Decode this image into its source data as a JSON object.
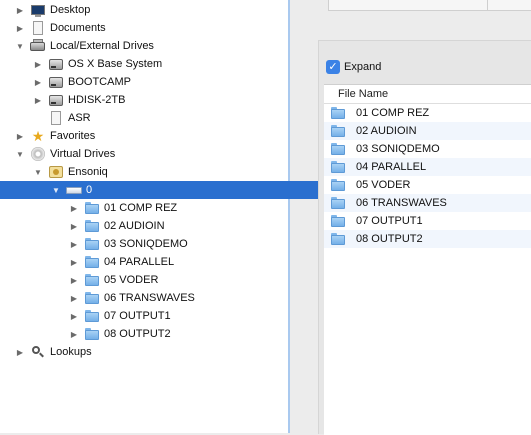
{
  "tree": {
    "items": [
      {
        "label": "Desktop",
        "icon": "desktop-icon",
        "expanded": false
      },
      {
        "label": "Documents",
        "icon": "documents-icon",
        "expanded": false
      },
      {
        "label": "Local/External Drives",
        "icon": "drives-icon",
        "expanded": true
      },
      {
        "label": "OS X Base System",
        "icon": "disk-icon",
        "expanded": false
      },
      {
        "label": "BOOTCAMP",
        "icon": "disk-icon",
        "expanded": false
      },
      {
        "label": "HDISK-2TB",
        "icon": "disk-icon",
        "expanded": false
      },
      {
        "label": "ASR",
        "icon": "document-icon",
        "expanded": false
      },
      {
        "label": "Favorites",
        "icon": "star-icon",
        "expanded": false
      },
      {
        "label": "Virtual Drives",
        "icon": "cd-icon",
        "expanded": true
      },
      {
        "label": "Ensoniq",
        "icon": "ensoniq-icon",
        "expanded": true
      },
      {
        "label": "0",
        "icon": "volume-icon",
        "expanded": true,
        "selected": true
      },
      {
        "label": "01 COMP REZ",
        "icon": "folder-icon",
        "expanded": false
      },
      {
        "label": "02 AUDIOIN",
        "icon": "folder-icon",
        "expanded": false
      },
      {
        "label": "03 SONIQDEMO",
        "icon": "folder-icon",
        "expanded": false
      },
      {
        "label": "04 PARALLEL",
        "icon": "folder-icon",
        "expanded": false
      },
      {
        "label": "05 VODER",
        "icon": "folder-icon",
        "expanded": false
      },
      {
        "label": "06 TRANSWAVES",
        "icon": "folder-icon",
        "expanded": false
      },
      {
        "label": "07 OUTPUT1",
        "icon": "folder-icon",
        "expanded": false
      },
      {
        "label": "08 OUTPUT2",
        "icon": "folder-icon",
        "expanded": false
      },
      {
        "label": "Lookups",
        "icon": "search-icon",
        "expanded": false
      }
    ]
  },
  "right_panel": {
    "expand_label": "Expand",
    "expand_checked": true,
    "column_header": "File Name",
    "files": [
      "01 COMP REZ",
      "02 AUDIOIN",
      "03 SONIQDEMO",
      "04 PARALLEL",
      "05 VODER",
      "06 TRANSWAVES",
      "07 OUTPUT1",
      "08 OUTPUT2"
    ]
  },
  "colors": {
    "selection": "#2a6fcf",
    "checkbox": "#3b82e6",
    "pane_border": "#a9c9ef"
  }
}
